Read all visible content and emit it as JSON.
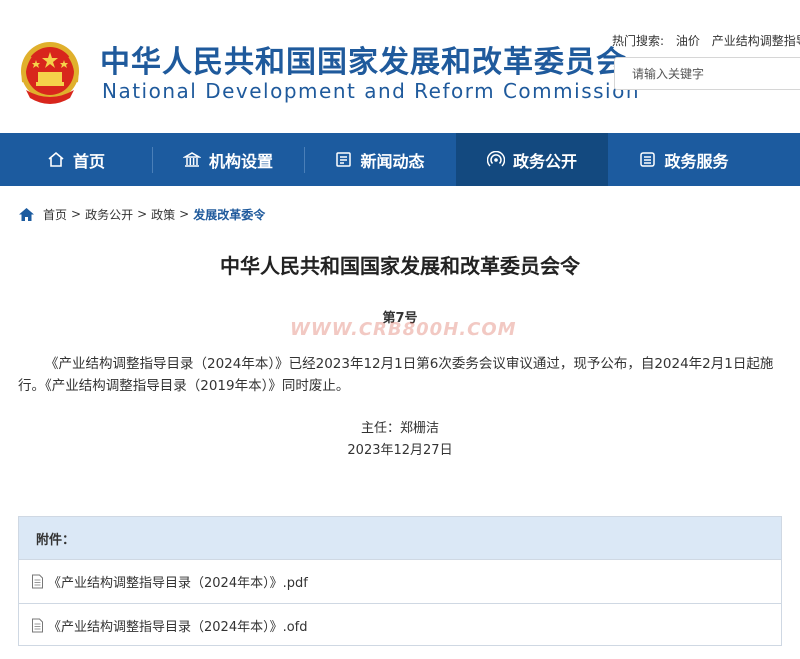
{
  "header": {
    "title_cn": "中华人民共和国国家发展和改革委员会",
    "title_en": "National Development and Reform Commission",
    "hot_search_label": "热门搜索:",
    "hot_search_items": [
      "油价",
      "产业结构调整指导目录"
    ],
    "search_placeholder": "请输入关键字"
  },
  "nav": {
    "items": [
      {
        "label": "首页",
        "icon": "home-icon"
      },
      {
        "label": "机构设置",
        "icon": "building-icon"
      },
      {
        "label": "新闻动态",
        "icon": "newspaper-icon"
      },
      {
        "label": "政务公开",
        "icon": "broadcast-icon",
        "active": true
      },
      {
        "label": "政务服务",
        "icon": "service-icon"
      }
    ]
  },
  "breadcrumb": {
    "items": [
      "首页",
      "政务公开",
      "政策"
    ],
    "current": "发展改革委令",
    "separator": ">"
  },
  "article": {
    "title": "中华人民共和国国家发展和改革委员会令",
    "doc_number": "第7号",
    "watermark": "WWW.CRB800H.COM",
    "body": "《产业结构调整指导目录（2024年本）》已经2023年12月1日第6次委务会议审议通过，现予公布，自2024年2月1日起施行。《产业结构调整指导目录（2019年本）》同时废止。",
    "director": "主任：郑栅洁",
    "date": "2023年12月27日"
  },
  "attachments": {
    "header": "附件：",
    "items": [
      {
        "label": "《产业结构调整指导目录（2024年本）》.pdf"
      },
      {
        "label": "《产业结构调整指导目录（2024年本）》.ofd"
      }
    ]
  },
  "colors": {
    "brand_blue": "#1c5b9f",
    "nav_active": "#13497f",
    "attach_header_bg": "#dbe8f6"
  }
}
